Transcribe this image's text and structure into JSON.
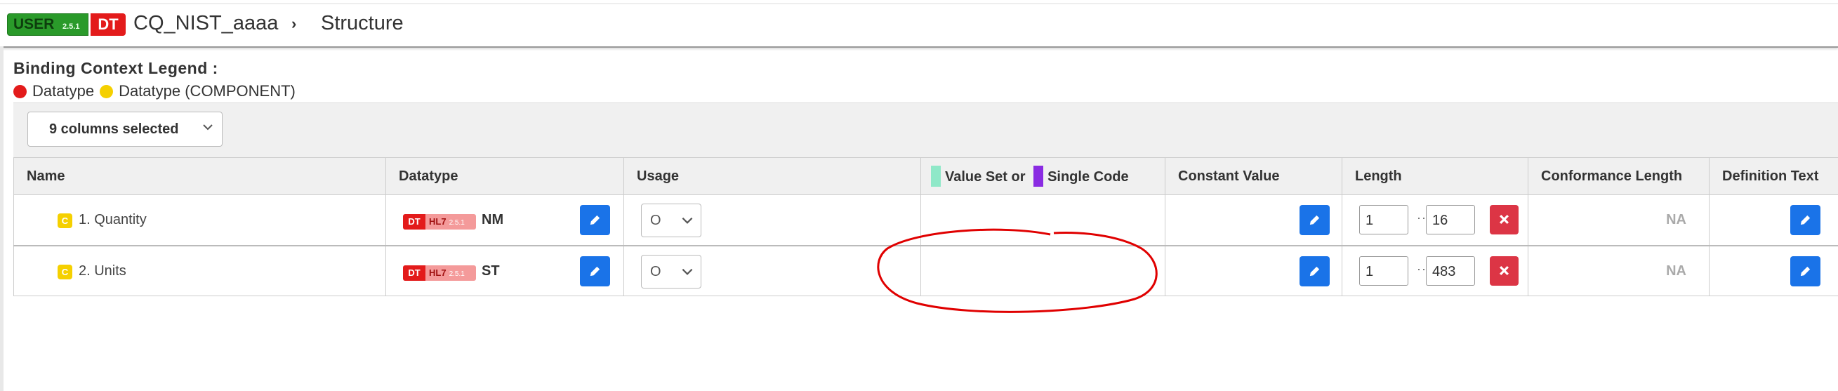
{
  "header": {
    "badge_user": "USER",
    "badge_user_version": "2.5.1",
    "badge_dt": "DT",
    "breadcrumb_title": "CQ_NIST_aaaa",
    "breadcrumb_separator": "›",
    "breadcrumb_current": "Structure"
  },
  "legend": {
    "title": "Binding Context Legend :",
    "items": [
      {
        "label": "Datatype",
        "color": "#e31b1b"
      },
      {
        "label": "Datatype (COMPONENT)",
        "color": "#f5d000"
      }
    ]
  },
  "toolbar": {
    "columns_selected": "9 columns selected"
  },
  "table": {
    "columns": [
      "Name",
      "Datatype",
      "Usage",
      "Value Set or",
      "Single Code",
      "Constant Value",
      "Length",
      "Conformance Length",
      "Definition Text"
    ],
    "rows": [
      {
        "badge": "C",
        "name": "1. Quantity",
        "dt_badge": "DT",
        "hl7_badge": "HL7",
        "hl7_version": "2.5.1",
        "datatype": "NM",
        "usage": "O",
        "length_min": "1",
        "length_sep": "··",
        "length_max": "16",
        "conformance_length": "NA"
      },
      {
        "badge": "C",
        "name": "2. Units",
        "dt_badge": "DT",
        "hl7_badge": "HL7",
        "hl7_version": "2.5.1",
        "datatype": "ST",
        "usage": "O",
        "length_min": "1",
        "length_sep": "··",
        "length_max": "483",
        "conformance_length": "NA"
      }
    ]
  },
  "icons": {
    "edit": "pencil-icon",
    "remove": "close-icon",
    "dropdown": "chevron-down-icon",
    "breadcrumb": "chevron-right-icon"
  },
  "colors": {
    "edit_button": "#1a73e8",
    "remove_button": "#dc3545",
    "value_set_marker": "#8fe8c8",
    "single_code_marker": "#8a2be2",
    "annotation": "#e00000"
  }
}
